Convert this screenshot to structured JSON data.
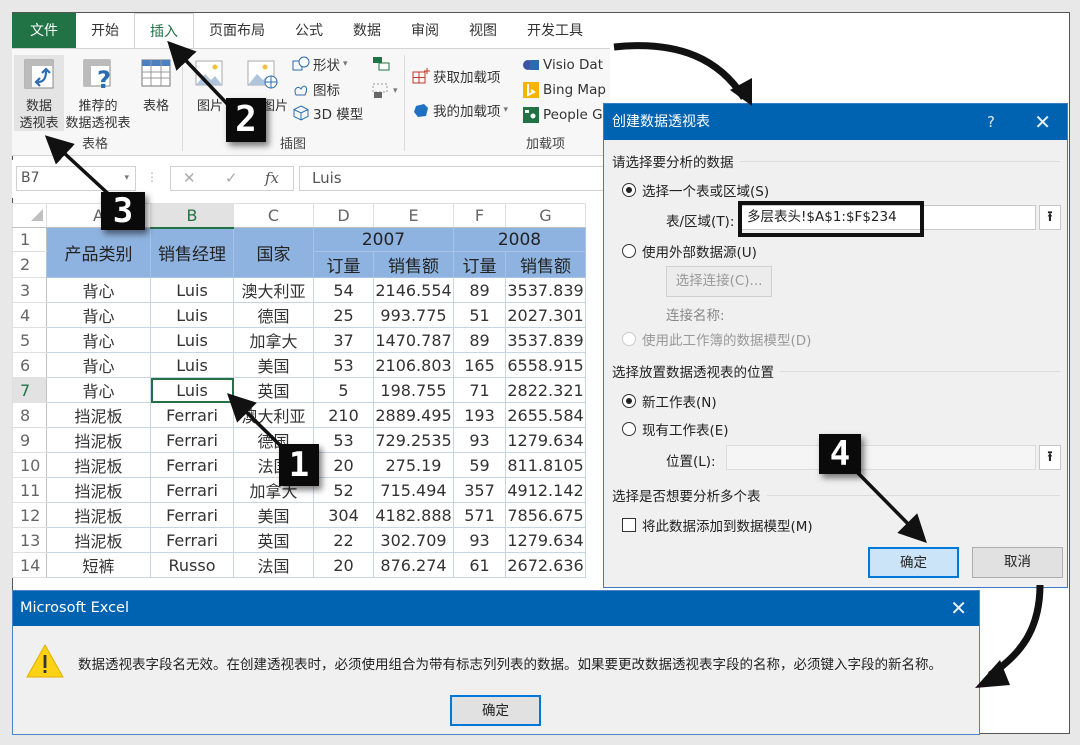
{
  "ribbon": {
    "tabs": [
      {
        "label": "文件",
        "type": "file"
      },
      {
        "label": "开始"
      },
      {
        "label": "插入",
        "active": true
      },
      {
        "label": "页面布局"
      },
      {
        "label": "公式"
      },
      {
        "label": "数据"
      },
      {
        "label": "审阅"
      },
      {
        "label": "视图"
      },
      {
        "label": "开发工具"
      }
    ],
    "groups": {
      "tables": {
        "label": "表格",
        "pivot_line1": "数据",
        "pivot_line2": "透视表",
        "recommended_line1": "推荐的",
        "recommended_line2": "数据透视表",
        "table": "表格"
      },
      "illustrations": {
        "label": "插图",
        "pictures": "图片",
        "online_pictures": "联机图片",
        "shapes": "形状",
        "icons": "图标",
        "model3d": "3D 模型"
      },
      "addins": {
        "label": "加载项",
        "get_addins": "获取加载项",
        "my_addins": "我的加载项",
        "visio": "Visio Dat",
        "bing": "Bing Map",
        "people": "People G"
      }
    }
  },
  "formula_bar": {
    "name_box": "B7",
    "cancel": "✕",
    "enter": "✓",
    "fx": "fx",
    "value": "Luis"
  },
  "sheet": {
    "columns": [
      "A",
      "B",
      "C",
      "D",
      "E",
      "F",
      "G"
    ],
    "header": {
      "product": "产品类别",
      "manager": "销售经理",
      "country": "国家",
      "year1": "2007",
      "year2": "2008",
      "orders": "订量",
      "sales": "销售额"
    },
    "rows": [
      {
        "n": "3",
        "cells": [
          "背心",
          "Luis",
          "澳大利亚",
          "54",
          "2146.554",
          "89",
          "3537.839"
        ]
      },
      {
        "n": "4",
        "cells": [
          "背心",
          "Luis",
          "德国",
          "25",
          "993.775",
          "51",
          "2027.301"
        ]
      },
      {
        "n": "5",
        "cells": [
          "背心",
          "Luis",
          "加拿大",
          "37",
          "1470.787",
          "89",
          "3537.839"
        ]
      },
      {
        "n": "6",
        "cells": [
          "背心",
          "Luis",
          "美国",
          "53",
          "2106.803",
          "165",
          "6558.915"
        ]
      },
      {
        "n": "7",
        "cells": [
          "背心",
          "Luis",
          "英国",
          "5",
          "198.755",
          "71",
          "2822.321"
        ]
      },
      {
        "n": "8",
        "cells": [
          "挡泥板",
          "Ferrari",
          "澳大利亚",
          "210",
          "2889.495",
          "193",
          "2655.584"
        ]
      },
      {
        "n": "9",
        "cells": [
          "挡泥板",
          "Ferrari",
          "德国",
          "53",
          "729.2535",
          "93",
          "1279.634"
        ]
      },
      {
        "n": "10",
        "cells": [
          "挡泥板",
          "Ferrari",
          "法国",
          "20",
          "275.19",
          "59",
          "811.8105"
        ]
      },
      {
        "n": "11",
        "cells": [
          "挡泥板",
          "Ferrari",
          "加拿大",
          "52",
          "715.494",
          "357",
          "4912.142"
        ]
      },
      {
        "n": "12",
        "cells": [
          "挡泥板",
          "Ferrari",
          "美国",
          "304",
          "4182.888",
          "571",
          "7856.675"
        ]
      },
      {
        "n": "13",
        "cells": [
          "挡泥板",
          "Ferrari",
          "英国",
          "22",
          "302.709",
          "93",
          "1279.634"
        ]
      },
      {
        "n": "14",
        "cells": [
          "短裤",
          "Russo",
          "法国",
          "20",
          "876.274",
          "61",
          "2672.636"
        ]
      }
    ]
  },
  "pivot_dialog": {
    "title": "创建数据透视表",
    "help": "?",
    "close": "✕",
    "section1": "请选择要分析的数据",
    "opt_range": "选择一个表或区域(S)",
    "range_label": "表/区域(T):",
    "range_value": "多层表头!$A$1:$F$234",
    "opt_external": "使用外部数据源(U)",
    "choose_conn": "选择连接(C)...",
    "conn_name": "连接名称:",
    "opt_model": "使用此工作簿的数据模型(D)",
    "section2": "选择放置数据透视表的位置",
    "opt_new": "新工作表(N)",
    "opt_existing": "现有工作表(E)",
    "location_label": "位置(L):",
    "location_value": "",
    "section3": "选择是否想要分析多个表",
    "add_model": "将此数据添加到数据模型(M)",
    "ok": "确定",
    "cancel": "取消",
    "collapse_icon": "⭱"
  },
  "message_box": {
    "title": "Microsoft Excel",
    "close": "✕",
    "text": "数据透视表字段名无效。在创建透视表时，必须使用组合为带有标志列列表的数据。如果要更改数据透视表字段的名称，必须键入字段的新名称。",
    "ok": "确定"
  },
  "annotations": {
    "step1": "1",
    "step2": "2",
    "step3": "3",
    "step4": "4"
  },
  "colors": {
    "excel_green": "#217346",
    "dialog_blue": "#0063b1",
    "header_fill": "#8fb3e0"
  }
}
